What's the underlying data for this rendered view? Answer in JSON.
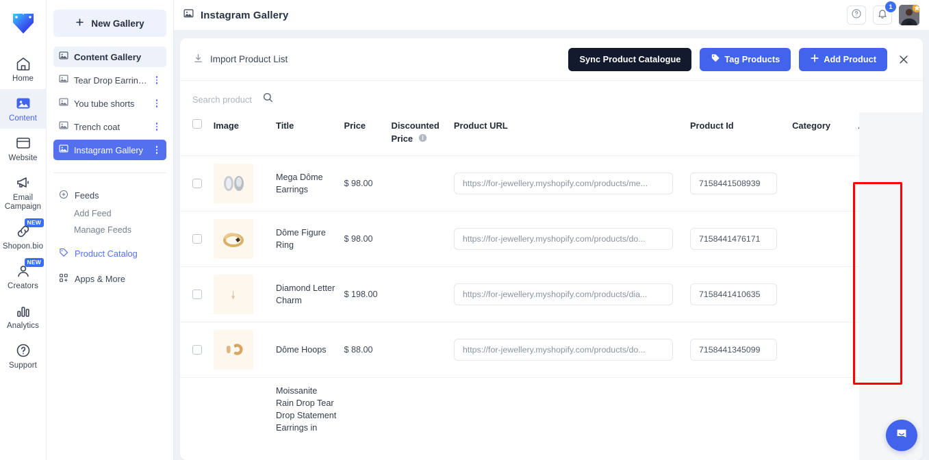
{
  "rail": {
    "logo_name": "heart-logo",
    "items": [
      {
        "label": "Home",
        "icon": "home-icon",
        "active": false,
        "badge": ""
      },
      {
        "label": "Content",
        "icon": "image-icon",
        "active": true,
        "badge": ""
      },
      {
        "label": "Website",
        "icon": "browser-icon",
        "active": false,
        "badge": ""
      },
      {
        "label": "Email Campaign",
        "icon": "megaphone-icon",
        "active": false,
        "badge": ""
      },
      {
        "label": "Shopon.bio",
        "icon": "link-icon",
        "active": false,
        "badge": "NEW"
      },
      {
        "label": "Creators",
        "icon": "user-icon",
        "active": false,
        "badge": "NEW"
      },
      {
        "label": "Analytics",
        "icon": "bar-chart-icon",
        "active": false,
        "badge": ""
      },
      {
        "label": "Support",
        "icon": "question-circle-icon",
        "active": false,
        "badge": ""
      }
    ]
  },
  "sidebar": {
    "new_gallery_label": "New Gallery",
    "content_gallery_label": "Content Gallery",
    "galleries": [
      {
        "label": "Tear Drop Earrings",
        "selected": false
      },
      {
        "label": "You tube shorts",
        "selected": false
      },
      {
        "label": "Trench coat",
        "selected": false
      },
      {
        "label": "Instagram Gallery",
        "selected": true
      }
    ],
    "feeds_label": "Feeds",
    "add_feed_label": "Add Feed",
    "manage_feeds_label": "Manage Feeds",
    "product_catalog_label": "Product Catalog",
    "apps_more_label": "Apps & More"
  },
  "topbar": {
    "title": "Instagram Gallery",
    "help_icon": "question-circle-icon",
    "bell_icon": "bell-icon",
    "notification_count": "1",
    "avatar_name": "user-avatar"
  },
  "toolbar": {
    "import_label": "Import Product List",
    "sync_label": "Sync Product Catalogue",
    "tag_label": "Tag Products",
    "add_product_label": "Add Product",
    "close_label": "×"
  },
  "search": {
    "placeholder": "Search product",
    "value": ""
  },
  "table": {
    "headers": {
      "image": "Image",
      "title": "Title",
      "price": "Price",
      "discounted_price": "Discounted Price",
      "product_url": "Product URL",
      "product_id": "Product Id",
      "category": "Category",
      "action": "Action"
    },
    "discount_info_icon": "info-icon",
    "rows": [
      {
        "title": "Mega Dôme Earrings",
        "price": "$ 98.00",
        "discounted_price": "",
        "url": "https://for-jewellery.myshopify.com/products/me...",
        "product_id": "7158441508939",
        "category": "",
        "thumb": "earrings-silver"
      },
      {
        "title": "Dôme Figure Ring",
        "price": "$ 98.00",
        "discounted_price": "",
        "url": "https://for-jewellery.myshopify.com/products/do...",
        "product_id": "7158441476171",
        "category": "",
        "thumb": "ring-gold"
      },
      {
        "title": "Diamond Letter Charm",
        "price": "$ 198.00",
        "discounted_price": "",
        "url": "https://for-jewellery.myshopify.com/products/dia...",
        "product_id": "7158441410635",
        "category": "",
        "thumb": "charm-small"
      },
      {
        "title": "Dôme Hoops",
        "price": "$ 88.00",
        "discounted_price": "",
        "url": "https://for-jewellery.myshopify.com/products/do...",
        "product_id": "7158441345099",
        "category": "",
        "thumb": "hoops-gold"
      },
      {
        "title": "Moissanite Rain Drop Tear Drop Statement Earrings in",
        "price": "",
        "discounted_price": "",
        "url": "",
        "product_id": "",
        "category": "",
        "thumb": ""
      }
    ],
    "edit_icon": "pencil-icon",
    "delete_icon": "trash-icon"
  },
  "chat": {
    "icon": "intercom-chat-icon"
  },
  "colors": {
    "accent": "#4263eb",
    "selected_nav": "#5570ee",
    "dark_button": "#131a2e",
    "page_bg": "#eef2f6",
    "highlight_box": "#ff0000",
    "action_col_bg": "#f5f6f8"
  }
}
